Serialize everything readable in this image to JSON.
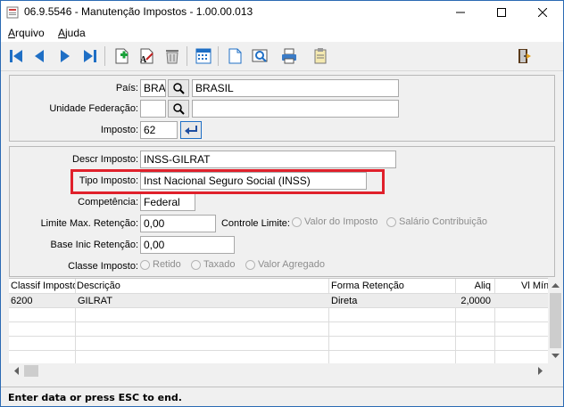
{
  "window": {
    "title": "06.9.5546 - Manutenção Impostos - 1.00.00.013",
    "min_icon": "minimize-icon",
    "max_icon": "maximize-icon",
    "close_icon": "close-icon"
  },
  "menu": {
    "items": [
      {
        "label": "Arquivo"
      },
      {
        "label": "Ajuda"
      }
    ]
  },
  "toolbar": {
    "icons": [
      "first-record-icon",
      "previous-record-icon",
      "next-record-icon",
      "last-record-icon",
      "add-icon",
      "edit-icon",
      "delete-icon",
      "calendar-icon",
      "new-document-icon",
      "preview-icon",
      "print-icon",
      "clipboard-icon",
      "exit-icon"
    ]
  },
  "header": {
    "pais_label": "País:",
    "pais_code": "BRA",
    "pais_name": "BRASIL",
    "uf_label": "Unidade Federação:",
    "uf_code": "",
    "uf_name": "",
    "imposto_label": "Imposto:",
    "imposto_value": "62"
  },
  "detail": {
    "descr_label": "Descr  Imposto:",
    "descr_value": "INSS-GILRAT",
    "tipo_label": "Tipo Imposto:",
    "tipo_value": "Inst Nacional Seguro Social (INSS)",
    "competencia_label": "Competência:",
    "competencia_value": "Federal",
    "limite_label": "Limite Max. Retenção:",
    "limite_value": "0,00",
    "controle_label": "Controle Limite:",
    "controle_options": [
      "Valor do Imposto",
      "Salário Contribuição"
    ],
    "base_label": "Base Inic Retenção:",
    "base_value": "0,00",
    "classe_label": "Classe Imposto:",
    "classe_options": [
      "Retido",
      "Taxado",
      "Valor Agregado"
    ]
  },
  "grid": {
    "columns": [
      "Classif Imposto",
      "Descrição",
      "Forma Retenção",
      "Aliq",
      "Vl Mín"
    ],
    "rows": [
      [
        "6200",
        "GILRAT",
        "Direta",
        "2,0000",
        ""
      ]
    ]
  },
  "status": {
    "text": "Enter data or press ESC to end."
  },
  "colors": {
    "highlight": "#e0202b",
    "toolbar_blue": "#1f6fc5"
  }
}
